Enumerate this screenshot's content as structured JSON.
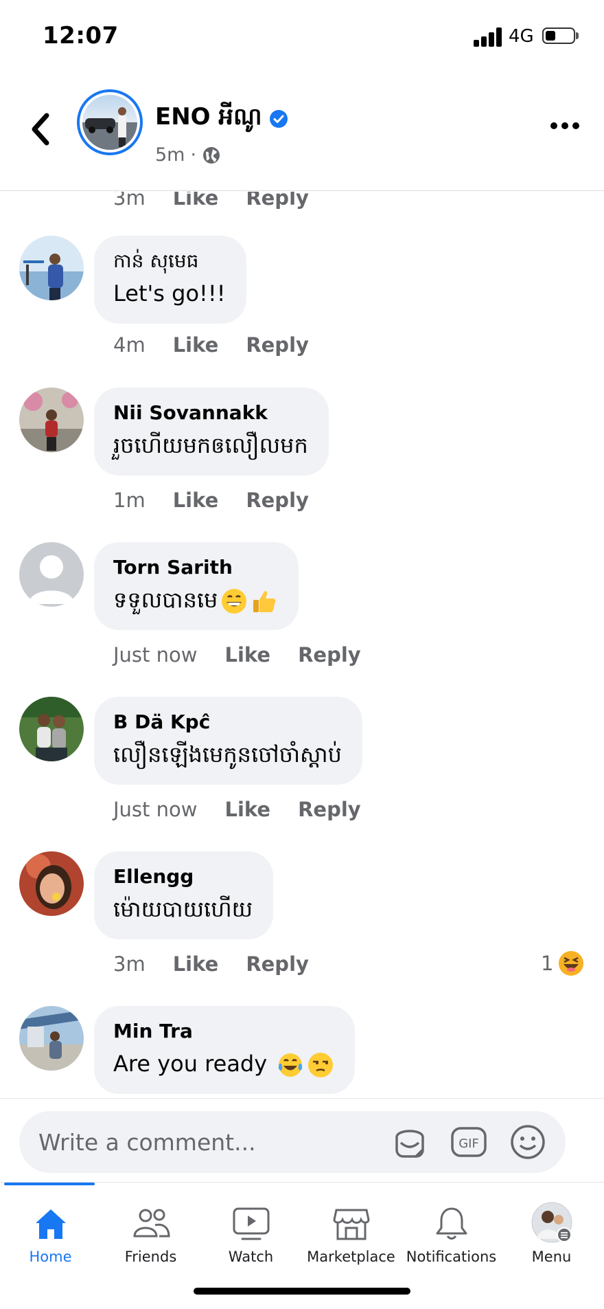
{
  "status_bar": {
    "time": "12:07",
    "network": "4G"
  },
  "header": {
    "page_name": "ENO អីណូ",
    "post_time": "5m",
    "separator": "·"
  },
  "top_meta": {
    "time": "3m",
    "like": "Like",
    "reply": "Reply"
  },
  "comments": [
    {
      "author": "កាន់ សុមេធ",
      "text": "Let's go!!!",
      "emoji": [],
      "time": "4m",
      "like": "Like",
      "reply": "Reply"
    },
    {
      "author": "Nii Sovannakk",
      "text": "រួចហើយមកឲលឿលមក",
      "emoji": [],
      "time": "1m",
      "like": "Like",
      "reply": "Reply"
    },
    {
      "author": "Torn Sarith",
      "text": "ទទួលបានមេ",
      "emoji": [
        "grinning-emoji",
        "thumbs-up-emoji"
      ],
      "time": "Just now",
      "like": "Like",
      "reply": "Reply"
    },
    {
      "author": "B Dä Kpĉ",
      "text": "លឿនឡើងមេកូនចៅចាំស្តាប់",
      "emoji": [],
      "time": "Just now",
      "like": "Like",
      "reply": "Reply"
    },
    {
      "author": "Ellengg",
      "text": "ម៉ោយបាយហើយ",
      "emoji": [],
      "time": "3m",
      "like": "Like",
      "reply": "Reply",
      "reaction_count": "1"
    },
    {
      "author": "Min Tra",
      "text": "Are you ready",
      "emoji": [
        "tears-of-joy-emoji",
        "unamused-emoji"
      ],
      "time": "",
      "like": "",
      "reply": ""
    }
  ],
  "composer": {
    "placeholder": "Write a comment...",
    "gif_label": "GIF"
  },
  "tabs": [
    {
      "label": "Home",
      "icon": "home-icon",
      "active": true
    },
    {
      "label": "Friends",
      "icon": "friends-icon"
    },
    {
      "label": "Watch",
      "icon": "watch-icon"
    },
    {
      "label": "Marketplace",
      "icon": "marketplace-icon"
    },
    {
      "label": "Notifications",
      "icon": "bell-icon"
    },
    {
      "label": "Menu",
      "icon": "profile-avatar-icon"
    }
  ],
  "colors": {
    "accent": "#1877f2",
    "bubble": "#f0f2f5",
    "secondary_text": "#65676b"
  }
}
